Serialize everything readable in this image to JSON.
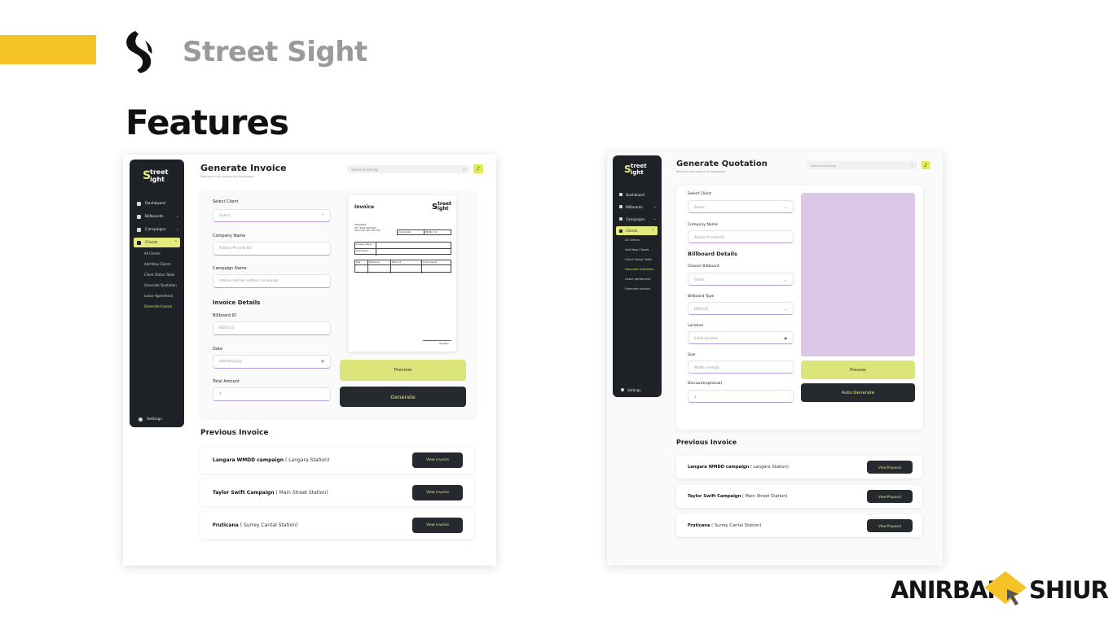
{
  "header": {
    "brand_name": "Street Sight",
    "section_title": "Features"
  },
  "colors": {
    "accent_yellow": "#f5c325",
    "lime": "#e3ea7b",
    "sidebar_dark": "#1e2126",
    "purple_preview": "#dcc7e6"
  },
  "sidebar": {
    "logo_line1": "treet",
    "logo_line2": "ight",
    "logo_s": "S",
    "items": [
      {
        "label": "Dashboard",
        "icon": "dashboard-icon"
      },
      {
        "label": "Billboards",
        "icon": "billboard-icon"
      },
      {
        "label": "Campaigns",
        "icon": "campaign-icon"
      },
      {
        "label": "Clients",
        "icon": "clients-icon"
      }
    ],
    "sub_items": [
      "All Clients",
      "Add New Clients",
      "Client Status Table",
      "Generate Quotation",
      "Lease Agreement",
      "Generate Invoice"
    ],
    "settings": "Settings"
  },
  "invoice_page": {
    "title": "Generate Invoice",
    "subtitle": "Welcome and explore the dashboard",
    "search_placeholder": "Search anything",
    "select_client_label": "Select Client",
    "select_client_value": "Select",
    "company_label": "Company Name",
    "company_value": "Adidas Private ltd",
    "campaign_label": "Campaign Name",
    "campaign_value": "Adidas limited edition campaign",
    "invoice_details": "Invoice Details",
    "billboard_id_label": "Billboard ID",
    "billboard_id_value": "BOO123",
    "date_label": "Date",
    "date_value": "dd/mm/yyyy",
    "total_label": "Total Amount",
    "total_value": "$",
    "preview_btn": "Preview",
    "generate_btn": "Generate",
    "paper": {
      "title": "Invoice",
      "addr1": "Streetsight",
      "addr2": "W77 Road 100 North",
      "addr3": "Vancouver, BC V7M 7H1",
      "invoice_date": "Invoice Date",
      "invoice_no": "INV000 - 01",
      "company_name": "Company Name",
      "client_name": "Client Name",
      "col1": "Billboard ID",
      "col2": "Period / Hr",
      "col3": "Invoice Amount",
      "col4": "Payment Status",
      "col0": "Date",
      "footer": "Signature"
    },
    "previous_title": "Previous Invoice",
    "previous": [
      {
        "name": "Langara WMDD campaign",
        "station": "( Langara Station)",
        "btn": "View invoice"
      },
      {
        "name": "Taylor Swift Campaign",
        "station": "( Main Street Station)",
        "btn": "View invoice"
      },
      {
        "name": "Fruticana",
        "station": "( Surrey Cantal Station)",
        "btn": "View invoice"
      }
    ]
  },
  "quotation_page": {
    "title": "Generate Quotation",
    "subtitle": "Welcome and explore the dashboard",
    "search_placeholder": "Search anything",
    "select_client_label": "Select Client",
    "select_client_value": "Select",
    "company_label": "Company Name",
    "company_value": "Adidas Private ltd",
    "billboard_details": "Billboard Details",
    "choose_billboard_label": "Choose Billboard",
    "choose_billboard_value": "Select",
    "billboard_type_label": "Billboard Type",
    "billboard_type_value": "BOO123",
    "location_label": "Location",
    "location_value": "Initial location",
    "size_label": "Size",
    "size_value": "Width x Height",
    "discount_label": "Discount(optional)",
    "discount_value": "$",
    "preview_btn": "Preview",
    "auto_generate_btn": "Auto Generate",
    "previous_title": "Previous Invoice",
    "previous": [
      {
        "name": "Langara WMDD campaign",
        "station": "( Langara Station)",
        "btn": "View Proposal"
      },
      {
        "name": "Taylor Swift Campaign",
        "station": "( Main Street Station)",
        "btn": "View Proposal"
      },
      {
        "name": "Fruticana",
        "station": "( Surrey Cantal Station)",
        "btn": "View Proposal"
      }
    ]
  },
  "watermark": {
    "left": "ANIRBAN",
    "right": "SHIUR"
  }
}
